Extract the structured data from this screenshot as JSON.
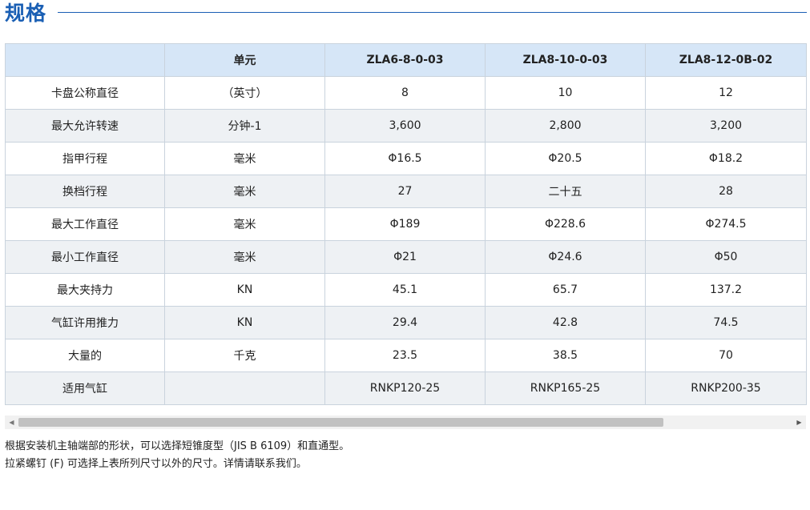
{
  "page": {
    "title": "规格"
  },
  "table": {
    "headers": [
      "",
      "单元",
      "ZLA6-8-0-03",
      "ZLA8-10-0-03",
      "ZLA8-12-0B-02"
    ],
    "rows": [
      [
        "卡盘公称直径",
        "（英寸）",
        "8",
        "10",
        "12"
      ],
      [
        "最大允许转速",
        "分钟-1",
        "3,600",
        "2,800",
        "3,200"
      ],
      [
        "指甲行程",
        "毫米",
        "Φ16.5",
        "Φ20.5",
        "Φ18.2"
      ],
      [
        "换档行程",
        "毫米",
        "27",
        "二十五",
        "28"
      ],
      [
        "最大工作直径",
        "毫米",
        "Φ189",
        "Φ228.6",
        "Φ274.5"
      ],
      [
        "最小工作直径",
        "毫米",
        "Φ21",
        "Φ24.6",
        "Φ50"
      ],
      [
        "最大夹持力",
        "KN",
        "45.1",
        "65.7",
        "137.2"
      ],
      [
        "气缸许用推力",
        "KN",
        "29.4",
        "42.8",
        "74.5"
      ],
      [
        "大量的",
        "千克",
        "23.5",
        "38.5",
        "70"
      ],
      [
        "适用气缸",
        "",
        "RNKP120-25",
        "RNKP165-25",
        "RNKP200-35"
      ]
    ]
  },
  "scrollbar": {
    "left_arrow": "◀",
    "right_arrow": "▶"
  },
  "notes": [
    "根据安装机主轴端部的形状，可以选择短锥度型（JIS B 6109）和直通型。",
    "拉紧螺钉 (F) 可选择上表所列尺寸以外的尺寸。详情请联系我们。"
  ],
  "colors": {
    "accent": "#1a5fb4",
    "header_bg": "#d6e6f7",
    "stripe_bg": "#eef1f4",
    "border": "#c9d3dd"
  }
}
